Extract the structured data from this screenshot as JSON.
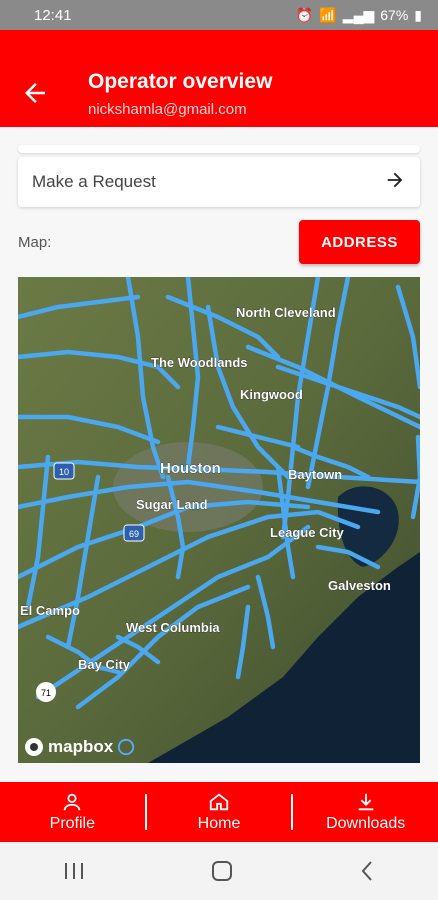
{
  "status_bar": {
    "time": "12:41",
    "battery": "67%"
  },
  "app_bar": {
    "title": "Operator overview",
    "subtitle": "nickshamla@gmail.com"
  },
  "request": {
    "label": "Make a Request"
  },
  "map_section": {
    "label": "Map:",
    "address_button": "ADDRESS",
    "labels": {
      "north_cleveland": "North Cleveland",
      "the_woodlands": "The Woodlands",
      "kingwood": "Kingwood",
      "houston": "Houston",
      "baytown": "Baytown",
      "sugar_land": "Sugar Land",
      "league_city": "League City",
      "galveston": "Galveston",
      "west_columbia": "West Columbia",
      "bay_city": "Bay City",
      "el_campo": "El Campo",
      "route_10": "10",
      "route_69": "69",
      "route_71": "71"
    },
    "brand": "mapbox"
  },
  "bottom_nav": [
    {
      "label": "Profile",
      "icon": "person-icon"
    },
    {
      "label": "Home",
      "icon": "home-icon"
    },
    {
      "label": "Downloads",
      "icon": "download-icon"
    }
  ],
  "colors": {
    "primary": "#ff0000",
    "pipeline": "#4aa8f0",
    "land": "#5a6b3a",
    "water": "#0f2236"
  }
}
